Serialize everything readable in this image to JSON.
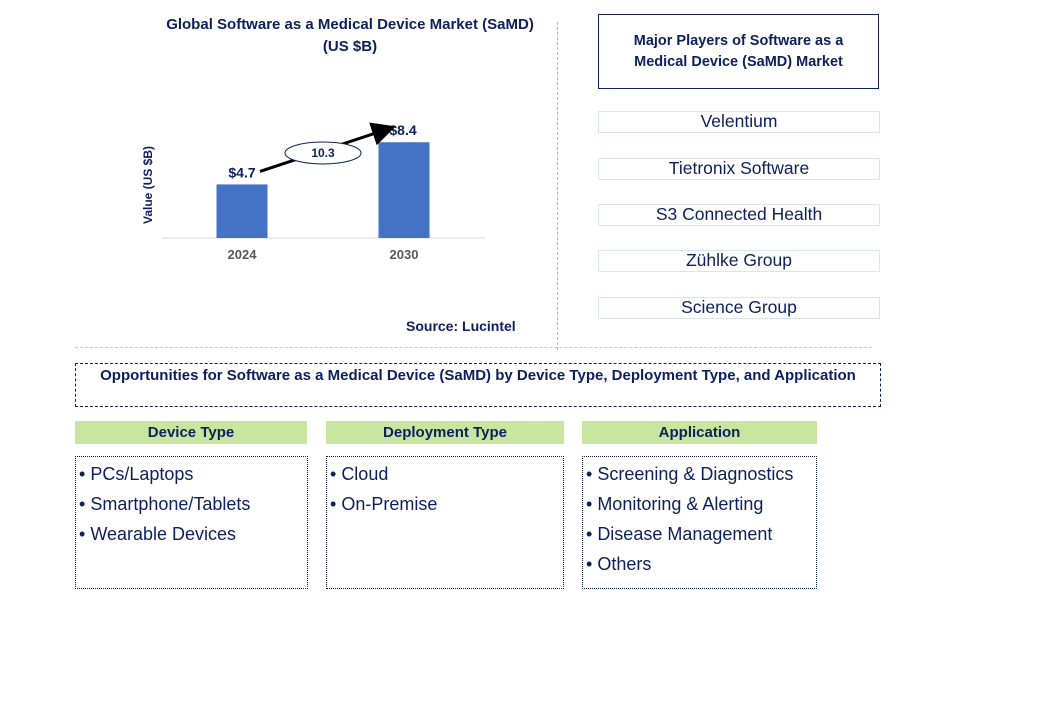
{
  "chart_data": {
    "type": "bar",
    "title": "Global Software as a Medical Device Market (SaMD) (US $B)",
    "title_line1": "Global Software as a Medical Device Market (SaMD)",
    "title_line2": "(US $B)",
    "ylabel": "Value (US $B)",
    "xlabel": "",
    "categories": [
      "2024",
      "2030"
    ],
    "values": [
      4.7,
      8.4
    ],
    "data_labels": [
      "$4.7",
      "$8.4"
    ],
    "ylim": [
      0,
      10
    ],
    "grid": false,
    "bar_color": "#4472c4",
    "annotation": {
      "label": "10.3",
      "meaning": "CAGR (%) from 2024 to 2030",
      "shape": "ellipse-with-arrow"
    }
  },
  "source": "Source: Lucintel",
  "players": {
    "title": "Major Players of Software as a Medical Device (SaMD) Market",
    "items": [
      "Velentium",
      "Tietronix Software",
      "S3 Connected Health",
      "Zühlke Group",
      "Science Group"
    ]
  },
  "opportunities": {
    "title": "Opportunities for Software as a Medical Device (SaMD) by Device Type, Deployment Type, and Application",
    "categories": [
      {
        "heading": "Device Type",
        "items": [
          "PCs/Laptops",
          "Smartphone/Tablets",
          "Wearable Devices"
        ]
      },
      {
        "heading": "Deployment Type",
        "items": [
          "Cloud",
          "On-Premise"
        ]
      },
      {
        "heading": "Application",
        "items": [
          "Screening & Diagnostics",
          "Monitoring & Alerting",
          "Disease Management",
          "Others"
        ]
      }
    ]
  },
  "colors": {
    "text": "#0d1f5c",
    "bar": "#4472c4",
    "header_fill": "#c8e6a0",
    "divider": "#f5b400",
    "player_border": "#d6e6f5"
  },
  "bullet": "•"
}
